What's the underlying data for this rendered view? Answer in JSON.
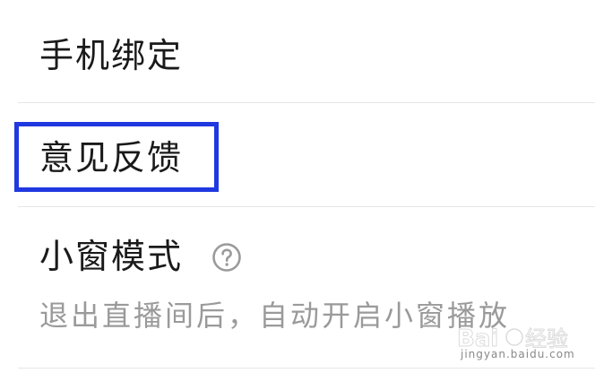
{
  "settings": {
    "items": [
      {
        "label": "手机绑定"
      },
      {
        "label": "意见反馈"
      },
      {
        "label": "小窗模式",
        "description": "退出直播间后，自动开启小窗播放",
        "icon": "help-circle-icon"
      }
    ]
  },
  "watermark": {
    "text": "jingyan.baidu.com"
  },
  "colors": {
    "highlight": "#1f38e0",
    "divider": "#e6e6e6",
    "text": "#1a1a1a",
    "subtext": "#9a9a9a"
  }
}
